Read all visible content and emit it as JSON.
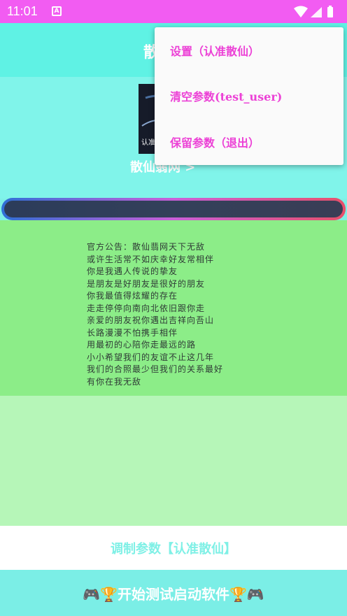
{
  "status_bar": {
    "time": "11:01",
    "app_icon_glyph": "A",
    "icons": [
      "wifi-icon",
      "signal-icon",
      "battery-icon"
    ]
  },
  "app_bar": {
    "title": "散"
  },
  "header": {
    "cover_text": "认准",
    "name": "散仙翡网 >"
  },
  "notice": {
    "lines": [
      "官方公告：散仙翡网天下无敌",
      "或许生活常不如庆幸好友常相伴",
      "你是我遇人传说的挚友",
      "是朋友是好朋友是很好的朋友",
      "你我最值得炫耀的存在",
      "走走停停向南向北依旧跟你走",
      "亲爱的朋友祝你遇出吉祥向吾山",
      "长路漫漫不怕携手相伴",
      "用最初的心陪你走最远的路",
      "小小希望我们的友谊不止这几年",
      "我们的合照最少但我们的关系最好",
      "有你在我无敌"
    ]
  },
  "buttons": {
    "copy": "调制参数【认准散仙】",
    "start": "🎮🏆开始测试启动软件🏆🎮"
  },
  "menu": {
    "items": [
      {
        "label": "设置（认准散仙）"
      },
      {
        "label": "清空参数(test_user)"
      },
      {
        "label": "保留参数（退出）"
      }
    ]
  },
  "colors": {
    "accent": "#ec41d6",
    "status_bar": "#f25cf2",
    "teal": "#7ff0e6",
    "green": "#8ced88"
  }
}
